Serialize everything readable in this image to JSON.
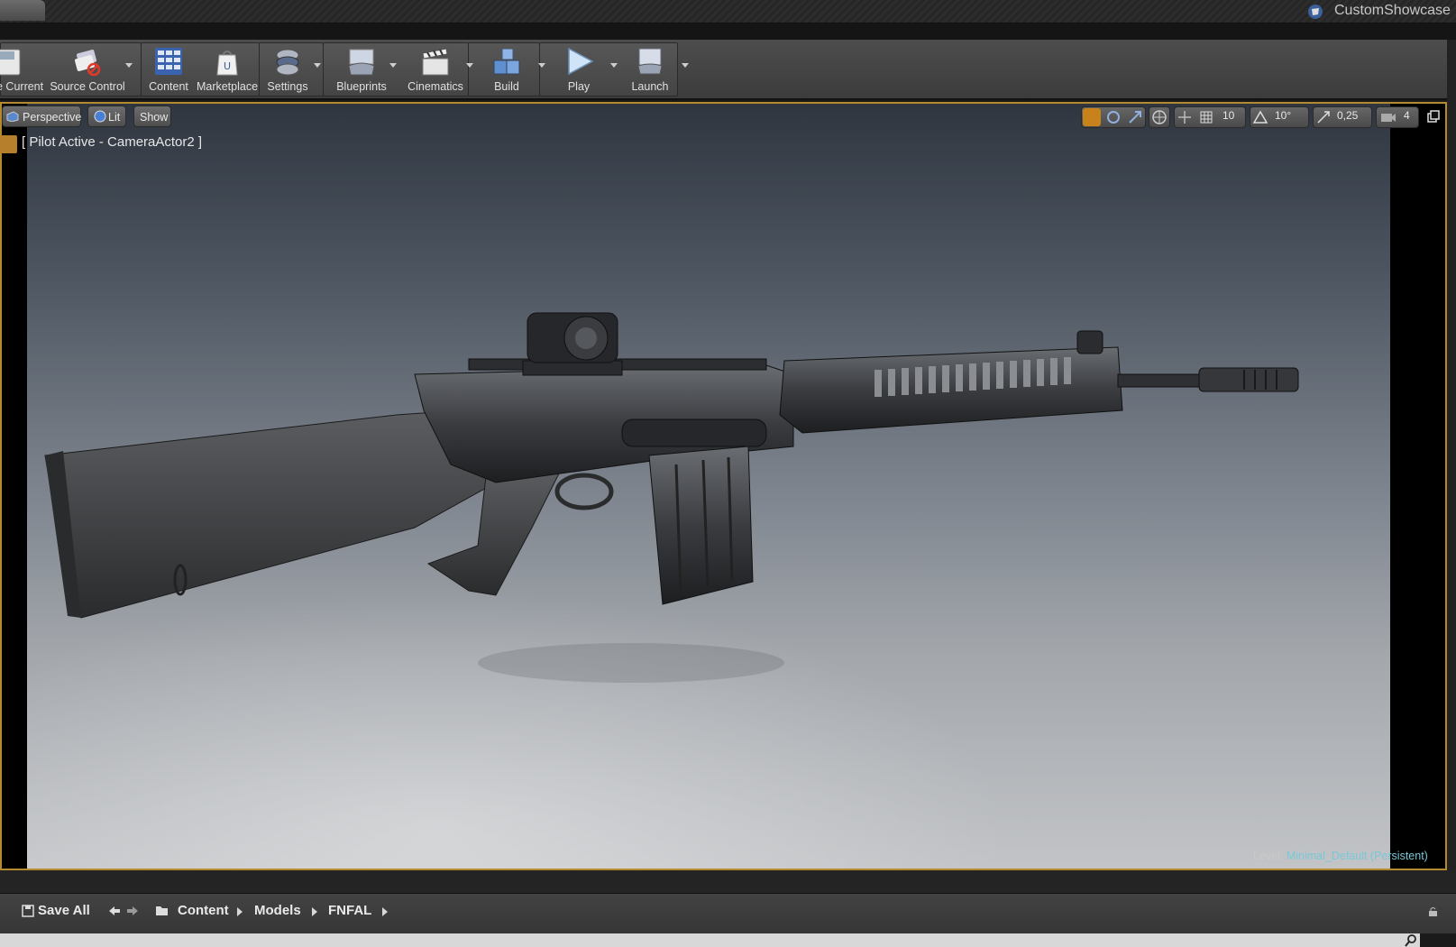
{
  "window": {
    "project_name": "CustomShowcase"
  },
  "toolbar": {
    "buttons": [
      {
        "label": "e Current",
        "icon": "save-icon"
      },
      {
        "label": "Source Control",
        "icon": "source-control-icon"
      },
      {
        "label": "Content",
        "icon": "content-grid-icon"
      },
      {
        "label": "Marketplace",
        "icon": "marketplace-bag-icon"
      },
      {
        "label": "Settings",
        "icon": "settings-gears-icon"
      },
      {
        "label": "Blueprints",
        "icon": "blueprints-gamepad-icon"
      },
      {
        "label": "Cinematics",
        "icon": "clapperboard-icon"
      },
      {
        "label": "Build",
        "icon": "build-blocks-icon"
      },
      {
        "label": "Play",
        "icon": "play-icon"
      },
      {
        "label": "Launch",
        "icon": "launch-monitor-icon"
      }
    ]
  },
  "viewport": {
    "view_mode": "Perspective",
    "lighting": "Lit",
    "show": "Show",
    "pilot_label": "[ Pilot Active - CameraActor2 ]",
    "grid_snap": "10",
    "rotation_snap": "10°",
    "scale_snap": "0,25",
    "camera_speed": "4",
    "level_prefix": "Level:",
    "level_name": "Minimal_Default (Persistent)",
    "accent_color": "#b58a2e"
  },
  "content_browser": {
    "save_all": "Save All",
    "breadcrumb": [
      "Content",
      "Models",
      "FNFAL"
    ]
  }
}
